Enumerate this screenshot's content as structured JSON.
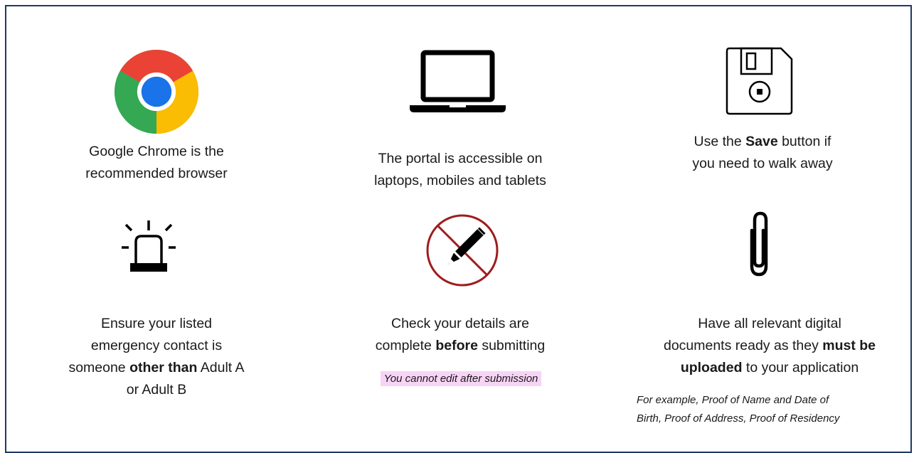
{
  "tips": {
    "chrome": {
      "icon": "chrome-logo-icon",
      "line1": "Google Chrome is the",
      "line2": "recommended browser"
    },
    "devices": {
      "icon": "laptop-icon",
      "line1": "The portal is accessible on",
      "line2": "laptops, mobiles and tablets"
    },
    "save": {
      "icon": "floppy-disk-icon",
      "line1_pre": "Use the ",
      "line1_bold": "Save",
      "line1_post": " button if",
      "line2": "you need to walk away"
    },
    "emergency": {
      "icon": "siren-icon",
      "line1": "Ensure your listed",
      "line2": "emergency contact is",
      "line3_pre": "someone ",
      "line3_bold": "other than",
      "line3_post": " Adult A",
      "line4": "or Adult B"
    },
    "check": {
      "icon": "no-edit-icon",
      "line1": "Check your details are",
      "line2_pre": "complete ",
      "line2_bold": "before",
      "line2_post": " submitting",
      "note": "You cannot edit after submission"
    },
    "documents": {
      "icon": "paperclip-icon",
      "line1": "Have all relevant digital",
      "line2_pre": "documents ready as they ",
      "line2_bold": "must be",
      "line3_bold": "uploaded",
      "line3_post": " to your application",
      "note_line1": "For example, Proof of Name and Date of",
      "note_line2": "Birth, Proof of Address, Proof of Residency"
    }
  },
  "colors": {
    "border": "#1f3864",
    "highlight": "#f7d4f5",
    "no_sign": "#9e1c1c"
  }
}
